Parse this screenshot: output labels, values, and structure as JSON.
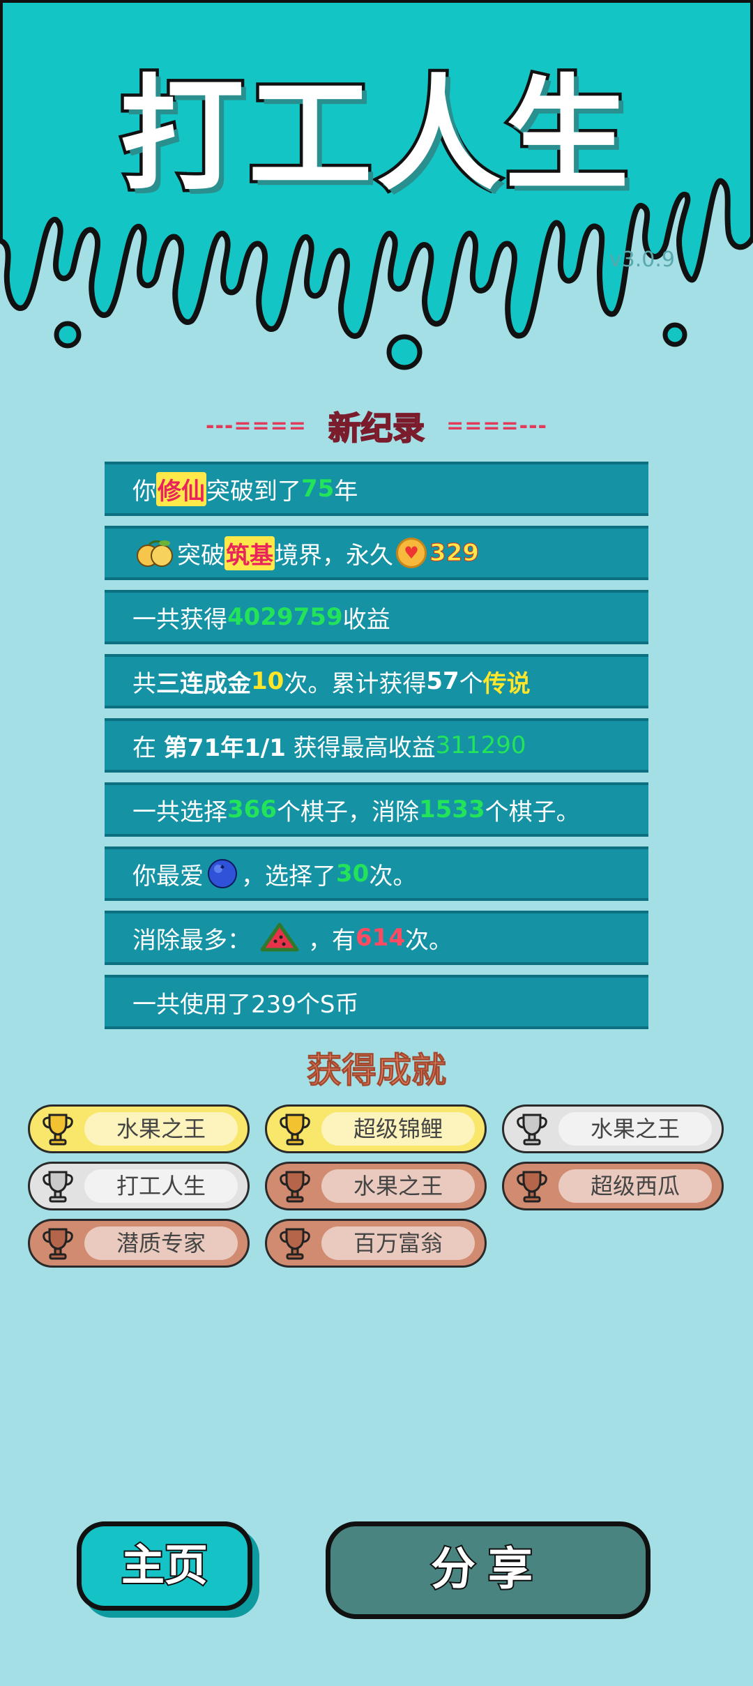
{
  "header": {
    "title": "打工人生",
    "version": "v3.0.9"
  },
  "record": {
    "title": "新纪录",
    "left_dashes": "---====",
    "right_dashes": "====---",
    "rows": {
      "r1": {
        "a": "你",
        "b": "修仙",
        "c": "突破到了",
        "d": "75",
        "e": "年"
      },
      "r2": {
        "a": "突破",
        "b": "筑基",
        "c": "境界，永久",
        "d": "329"
      },
      "r3": {
        "a": "一共获得",
        "b": "4029759",
        "c": "收益"
      },
      "r4": {
        "a": "共",
        "b": "三连成金",
        "c": "10",
        "d": "次。累计获得",
        "e": "57",
        "f": "个",
        "g": "传说"
      },
      "r5": {
        "a": "在 ",
        "b": "第71年1/1",
        "c": " 获得最高收益",
        "d": "311290"
      },
      "r6": {
        "a": "一共选择",
        "b": "366",
        "c": "个棋子，消除",
        "d": "1533",
        "e": "个棋子。"
      },
      "r7": {
        "a": "你最爱",
        "b": "，选择了",
        "c": "30",
        "d": "次。"
      },
      "r8": {
        "a": "消除最多：",
        "b": "，有",
        "c": "614",
        "d": "次。"
      },
      "r9": {
        "a": "一共使用了239个S币"
      }
    }
  },
  "achievements": {
    "title": "获得成就",
    "items": [
      {
        "label": "水果之王",
        "tier": "gold"
      },
      {
        "label": "超级锦鲤",
        "tier": "gold"
      },
      {
        "label": "水果之王",
        "tier": "silver"
      },
      {
        "label": "打工人生",
        "tier": "silver"
      },
      {
        "label": "水果之王",
        "tier": "bronze"
      },
      {
        "label": "超级西瓜",
        "tier": "bronze"
      },
      {
        "label": "潜质专家",
        "tier": "bronze"
      },
      {
        "label": "百万富翁",
        "tier": "bronze"
      }
    ]
  },
  "buttons": {
    "home": "主页",
    "share": "分享"
  },
  "colors": {
    "teal_top": "#14c5c6",
    "page_bg": "#a3dfe5",
    "row_bg": "#1592a4",
    "highlight_green": "#22e35a",
    "highlight_yellow": "#ffe629",
    "highlight_red": "#ff4a62"
  },
  "icons": {
    "orange_pair": "orange-pair-icon",
    "coin": "heart-coin-icon",
    "blueberry": "blueberry-icon",
    "watermelon": "watermelon-icon",
    "trophy": "trophy-icon"
  }
}
